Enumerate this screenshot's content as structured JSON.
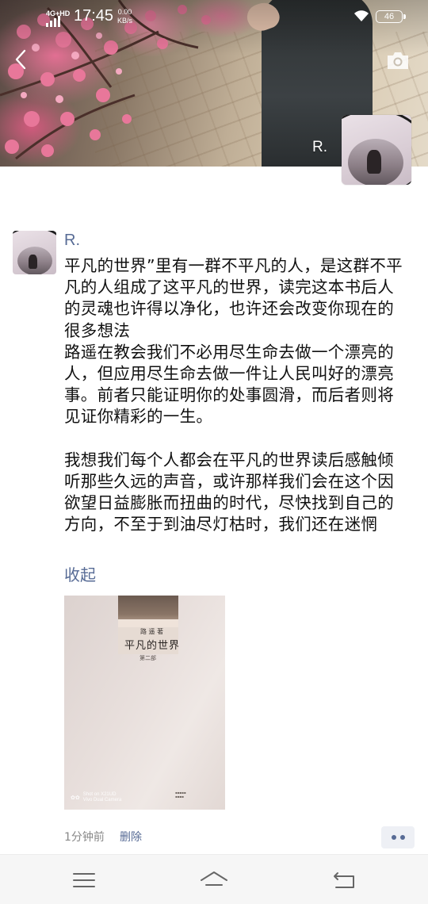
{
  "status_bar": {
    "network": "4G+HD",
    "time": "17:45",
    "speed_value": "0.00",
    "speed_unit": "KB/s",
    "battery": "46"
  },
  "header": {
    "back_icon": "chevron-left-icon",
    "camera_icon": "camera-icon",
    "cover_name": "R."
  },
  "post": {
    "author": "R.",
    "paragraphs": [
      "平凡的世界”里有一群不平凡的人，是这群不平凡的人组成了这平凡的世界，读完这本书后人的灵魂也许得以净化，也许还会改变你现在的很多想法",
      "路遥在教会我们不必用尽生命去做一个漂亮的人，但应用尽生命去做一件让人民叫好的漂亮事。前者只能证明你的处事圆滑，而后者则将见证你精彩的一生。",
      "我想我们每个人都会在平凡的世界读后感触倾听那些久远的声音，或许那样我们会在这个因欲望日益膨胀而扭曲的时代，尽快找到自己的方向，不至于到油尽灯枯时，我们还在迷惘"
    ],
    "collapse_label": "收起",
    "photo": {
      "book_author": "路 遥 著",
      "book_title": "平凡的世界",
      "book_volume": "第二部",
      "watermark_line1": "Shot on X21UD",
      "watermark_line2": "Vivo Dual Camera"
    },
    "time_ago": "1分钟前",
    "delete_label": "删除"
  },
  "colors": {
    "link": "#576b95",
    "meta_gray": "#888888",
    "nav_bg": "#f6f6f6"
  },
  "nav_bar": {
    "menu_icon": "menu-icon",
    "home_icon": "home-icon",
    "back_icon": "back-arrow-icon"
  }
}
